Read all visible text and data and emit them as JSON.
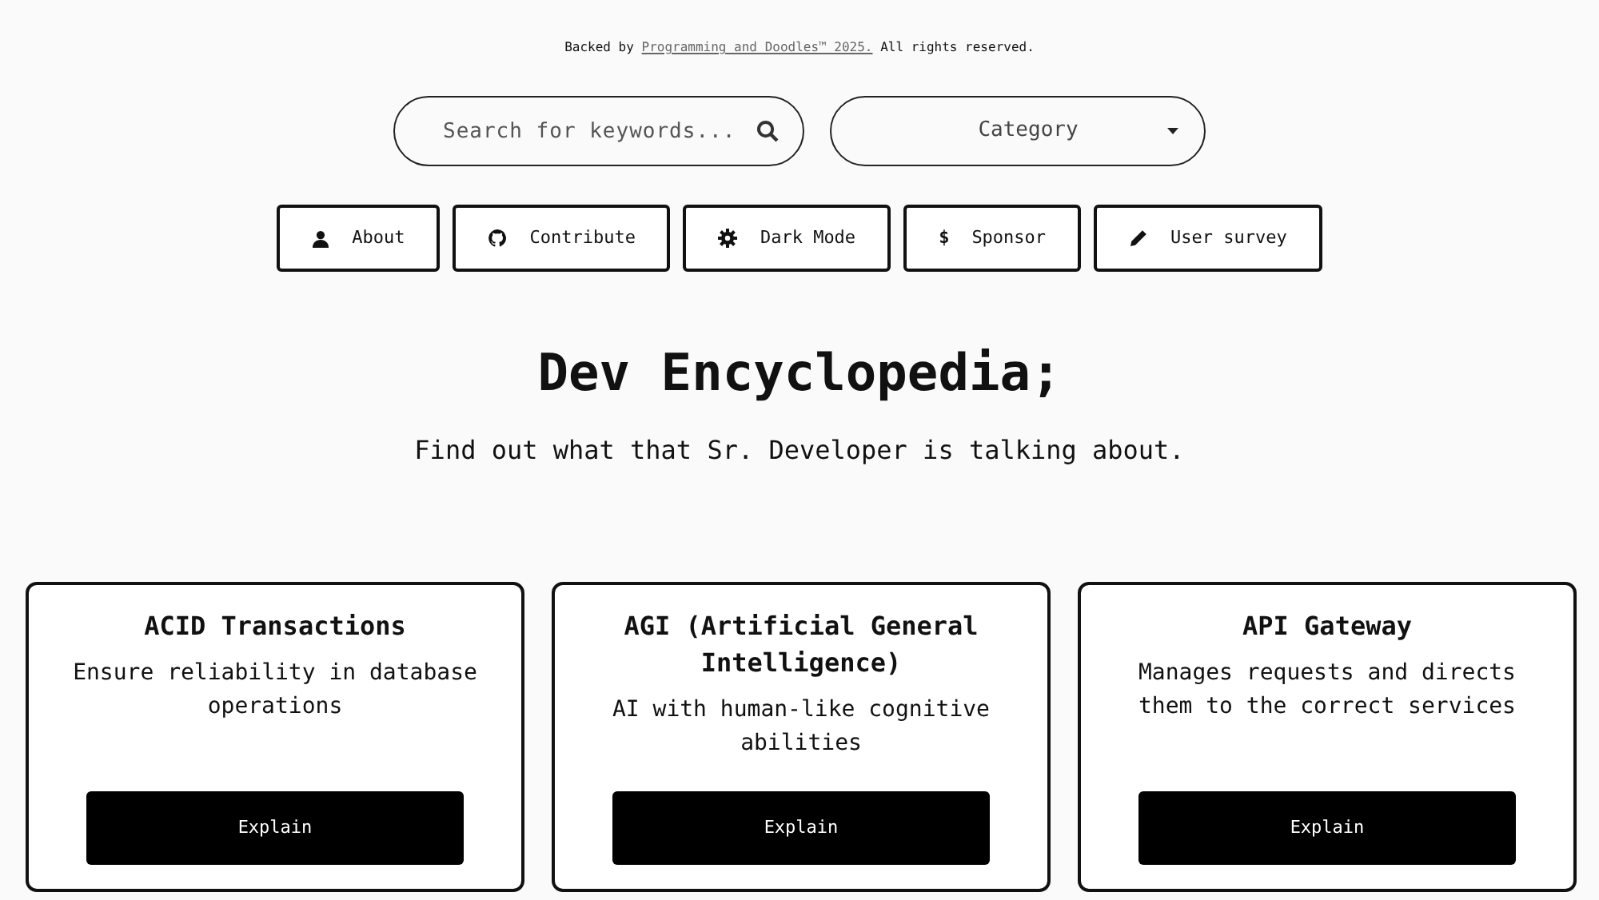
{
  "footer": {
    "before": "Backed by ",
    "link": "Programming and Doodles™ 2025.",
    "after": " All rights reserved."
  },
  "search": {
    "placeholder": "Search for keywords..."
  },
  "category": {
    "value": "Category"
  },
  "nav_buttons": [
    {
      "label": "About"
    },
    {
      "label": "Contribute"
    },
    {
      "label": "Dark Mode"
    },
    {
      "label": "Sponsor",
      "glyph": "$"
    },
    {
      "label": "User survey"
    }
  ],
  "title": "Dev Encyclopedia;",
  "subtitle": "Find out what that Sr. Developer is talking about.",
  "cards": [
    {
      "title": "ACID Transactions",
      "description": "Ensure reliability in database operations",
      "button": "Explain"
    },
    {
      "title": "AGI (Artificial General Intelligence)",
      "description": "AI with human-like cognitive abilities",
      "button": "Explain"
    },
    {
      "title": "API Gateway",
      "description": "Manages requests and directs them to the correct services",
      "button": "Explain"
    }
  ]
}
